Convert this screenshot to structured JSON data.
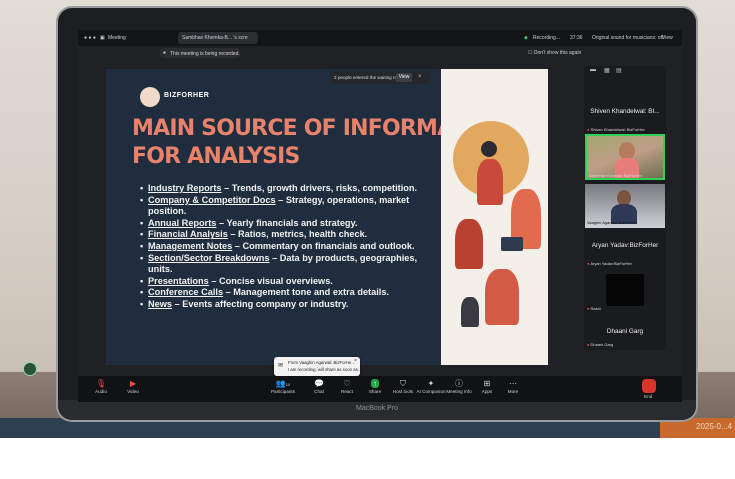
{
  "window": {
    "tab_meeting": "Meeting",
    "tab_share": "Sambhav Khemka-B... 's scre",
    "recording_status": "Recording...",
    "time": "37:36",
    "original_sound": "Original sound for musicians: off",
    "view_button": "View"
  },
  "recording_notice": {
    "text": "This meeting is being recorded.",
    "dont_show": "Don't show this again"
  },
  "waiting_room": {
    "text": "2 people entered the waiting room",
    "view_label": "View"
  },
  "slide": {
    "brand": "BIZFORHER",
    "headline_line1": "MAIN SOURCE OF INFORMATION",
    "headline_line2": "FOR ANALYSIS",
    "bullets": [
      {
        "key": "Industry Reports",
        "text": " – Trends, growth drivers, risks, competition."
      },
      {
        "key": "Company & Competitor Docs",
        "text": " – Strategy, operations, market position."
      },
      {
        "key": "Annual Reports",
        "text": " – Yearly financials and strategy."
      },
      {
        "key": "Financial Analysis",
        "text": " – Ratios, metrics, health check."
      },
      {
        "key": "Management Notes",
        "text": " – Commentary on financials and outlook."
      },
      {
        "key": "Section/Sector Breakdowns",
        "text": " – Data by products, geographies, units."
      },
      {
        "key": "Presentations",
        "text": " – Concise visual overviews."
      },
      {
        "key": "Conference Calls",
        "text": " – Management tone and extra details."
      },
      {
        "key": "News",
        "text": " – Events affecting company or industry."
      }
    ]
  },
  "participants": {
    "speaker_name": "Shiven Khandelwal: BI...",
    "speaker_sub": "Shiven Khandelwal: BizForHer",
    "video1_label": "Sambhav Khemka: BizForHer",
    "video2_label": "Vaaghin Agarwal: BizForHer",
    "aryan_name": "Aryan Yadav:BizForHer",
    "aryan_sub": "Aryan Yadav:BizForHer",
    "rashi_label": "Rashi",
    "dhaani_name": "Dhaani Garg",
    "dhaani_sub": "Dhaani Garg"
  },
  "chat_toast": {
    "from": "From Vaaghin Agarwal: BizForHe...",
    "message": "I am recording, will share as soon as..."
  },
  "toolbar": {
    "audio": "Audio",
    "video": "Video",
    "participants": "Participants",
    "participants_count": "10",
    "chat": "Chat",
    "react": "React",
    "share": "Share",
    "host_tools": "Host tools",
    "ai_companion": "AI Companion",
    "meeting_info": "Meeting Info",
    "apps": "Apps",
    "more": "More",
    "end": "End"
  },
  "device": {
    "bezel_label": "MacBook Pro",
    "corner_text": "2025-0...4"
  },
  "colors": {
    "slide_bg": "#1f2d3f",
    "headline": "#e8826a",
    "active_speaker": "#30d158",
    "end_red": "#d9352b"
  }
}
